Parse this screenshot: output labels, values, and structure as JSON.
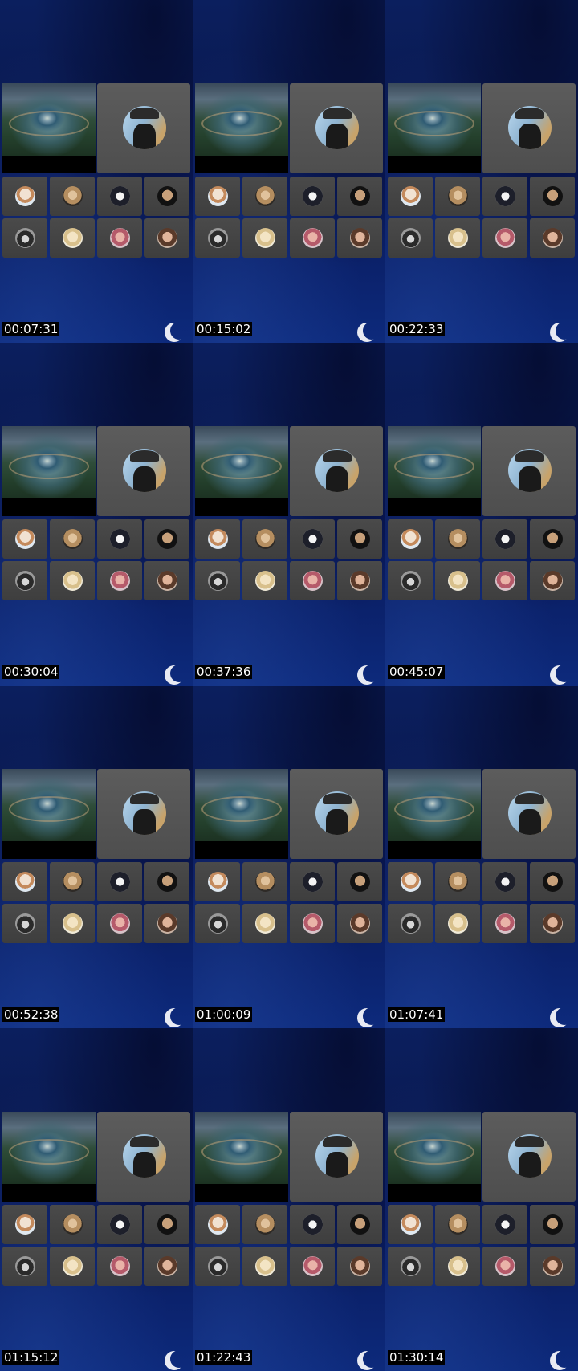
{
  "contact_sheet": {
    "columns": 3,
    "rows": 4,
    "frames": [
      {
        "timestamp": "00:07:31"
      },
      {
        "timestamp": "00:15:02"
      },
      {
        "timestamp": "00:22:33"
      },
      {
        "timestamp": "00:30:04"
      },
      {
        "timestamp": "00:37:36"
      },
      {
        "timestamp": "00:45:07"
      },
      {
        "timestamp": "00:52:38"
      },
      {
        "timestamp": "01:00:09"
      },
      {
        "timestamp": "01:07:41"
      },
      {
        "timestamp": "01:15:12"
      },
      {
        "timestamp": "01:22:43"
      },
      {
        "timestamp": "01:30:14"
      }
    ]
  },
  "meeting": {
    "shared_content": "fantasy-landscape-image",
    "presenter_avatar": "man-in-cowboy-hat-avatar",
    "participant_avatars": [
      "participant-1-avatar",
      "participant-2-avatar",
      "participant-3-avatar",
      "participant-4-avatar",
      "participant-5-avatar",
      "participant-6-avatar",
      "participant-7-avatar",
      "participant-8-avatar"
    ]
  },
  "colors": {
    "background": "#0a1a52",
    "tile": "#444444",
    "timestamp_bg": "#000000",
    "timestamp_text": "#ffffff"
  }
}
